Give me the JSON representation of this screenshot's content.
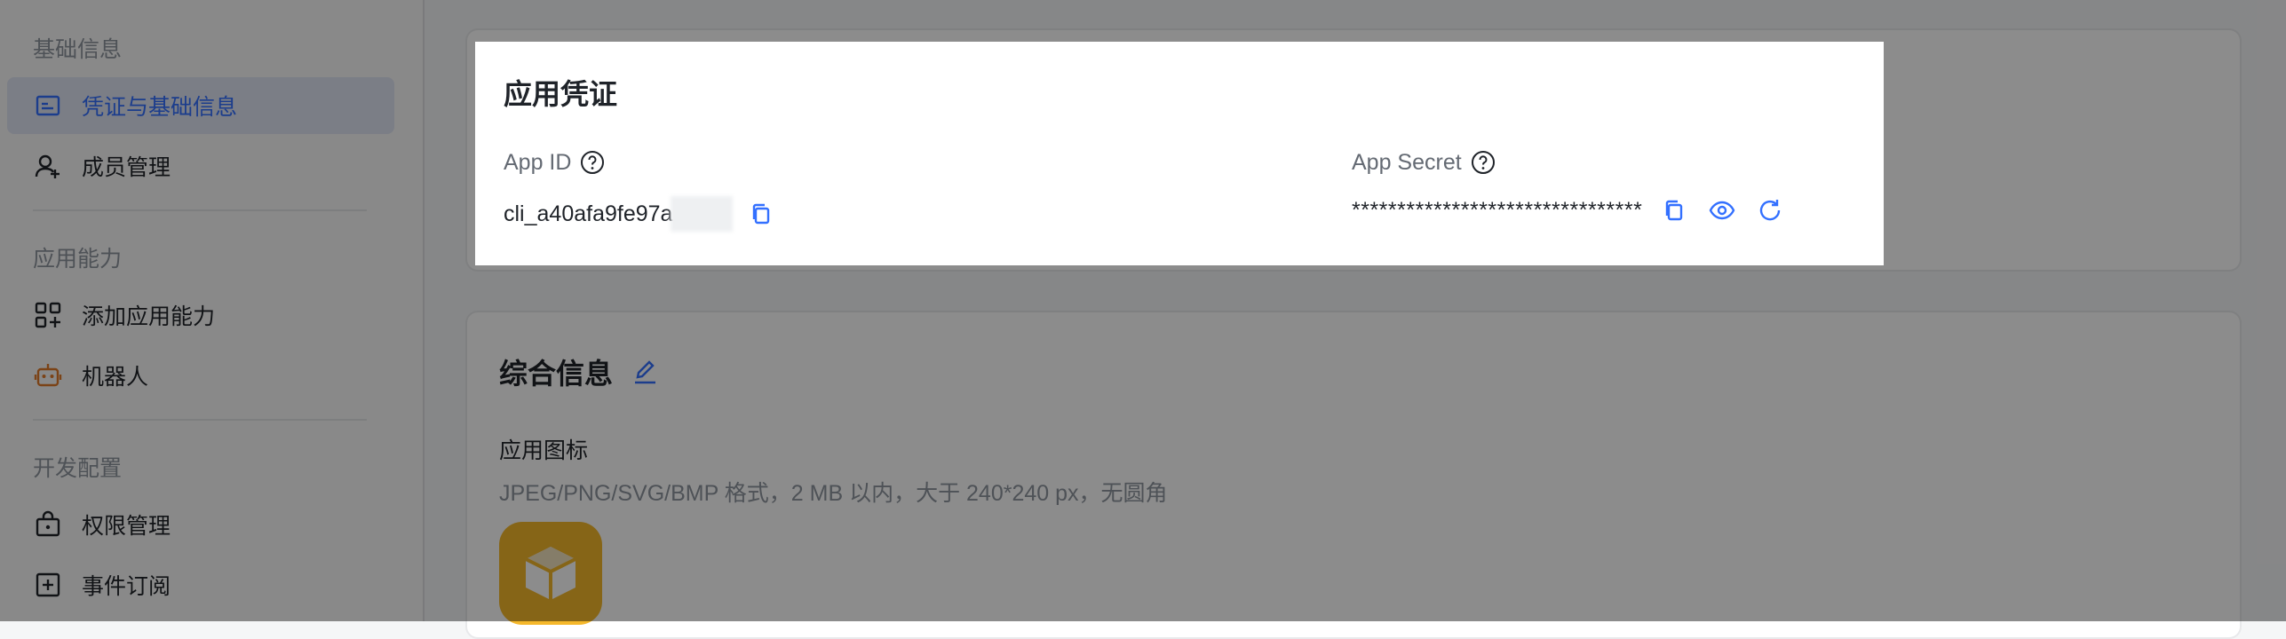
{
  "sidebar": {
    "groups": [
      {
        "title": "基础信息"
      },
      {
        "title": "应用能力"
      },
      {
        "title": "开发配置"
      }
    ],
    "items": [
      {
        "label": "凭证与基础信息",
        "icon": "credential-icon"
      },
      {
        "label": "成员管理",
        "icon": "add-member-icon"
      },
      {
        "label": "添加应用能力",
        "icon": "app-grid-icon"
      },
      {
        "label": "机器人",
        "icon": "robot-icon"
      },
      {
        "label": "权限管理",
        "icon": "permission-icon"
      },
      {
        "label": "事件订阅",
        "icon": "event-subscribe-icon"
      }
    ]
  },
  "credentials": {
    "title": "应用凭证",
    "app_id_label": "App ID",
    "app_id_value": "cli_a40afa9fe97a",
    "app_secret_label": "App Secret",
    "app_secret_value": "********************************"
  },
  "general": {
    "title": "综合信息",
    "icon_label": "应用图标",
    "icon_hint": "JPEG/PNG/SVG/BMP 格式，2 MB 以内，大于 240*240 px，无圆角"
  },
  "colors": {
    "accent": "#3370ff",
    "app_icon_bg": "#f5b82b",
    "robot_icon": "#e07b2a"
  }
}
